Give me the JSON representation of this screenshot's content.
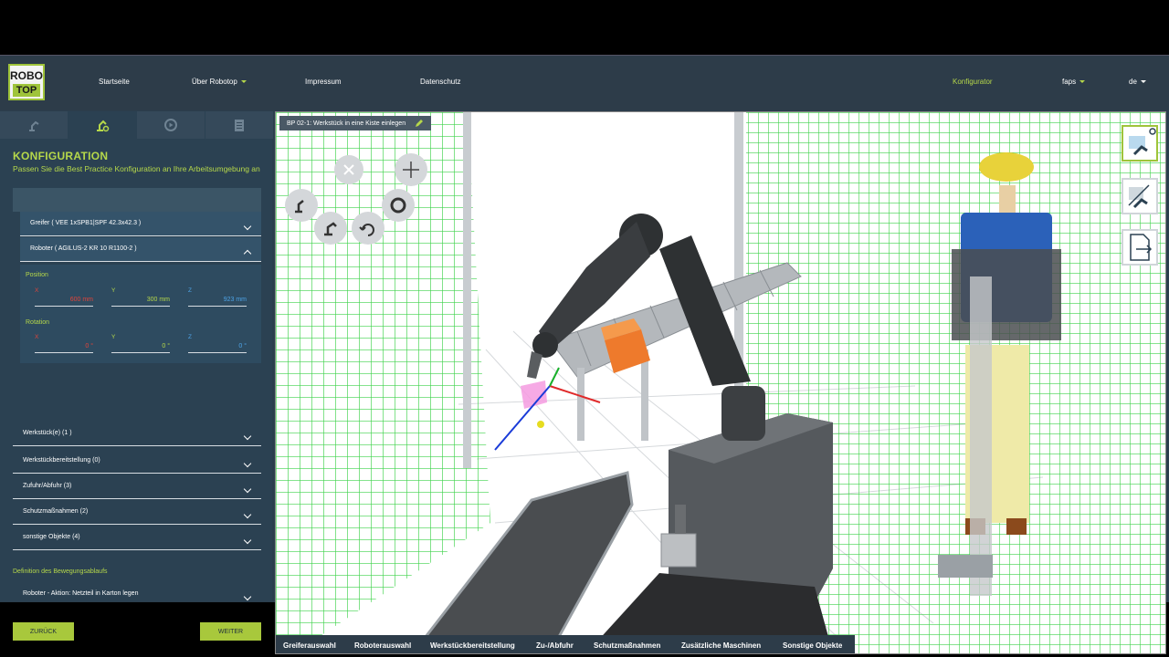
{
  "logo": {
    "line1": "ROBO",
    "line2": "TOP"
  },
  "nav": {
    "home": "Startseite",
    "about": "Über Robotop",
    "impressum": "Impressum",
    "privacy": "Datenschutz",
    "configurator": "Konfigurator",
    "user": "faps",
    "lang": "de"
  },
  "sidebar": {
    "title": "KONFIGURATION",
    "subtitle": "Passen Sie die Best Practice Konfiguration an Ihre Arbeitsumgebung an",
    "sections": [
      {
        "label": "Greifer ( VEE 1xSPB1|SPF 42.3x42.3 )"
      },
      {
        "label": "Roboter ( AGILUS-2 KR 10 R1100-2 )"
      },
      {
        "label": "Werkstück(e) (1 )"
      },
      {
        "label": "Werkstückbereitstellung (0)"
      },
      {
        "label": "Zufuhr/Abfuhr (3)"
      },
      {
        "label": "Schutzmaßnahmen (2)"
      },
      {
        "label": "sonstige Objekte (4)"
      }
    ],
    "position": {
      "label": "Position",
      "x_label": "X",
      "x_value": "600",
      "x_unit": "mm",
      "y_label": "Y",
      "y_value": "300",
      "y_unit": "mm",
      "z_label": "Z",
      "z_value": "923",
      "z_unit": "mm"
    },
    "rotation": {
      "label": "Rotation",
      "x_label": "X",
      "x_value": "0",
      "x_unit": "°",
      "y_label": "Y",
      "y_value": "0",
      "y_unit": "°",
      "z_label": "Z",
      "z_value": "0",
      "z_unit": "°"
    },
    "motion_heading": "Definition des Bewegungsablaufs",
    "motion_item": "Roboter - Aktion: Netzteil in Karton legen",
    "back_button": "ZURÜCK",
    "next_button": "WEITER"
  },
  "viewport": {
    "title": "BP 02-1: Werkstück in eine Kiste einlegen"
  },
  "bottombar": {
    "items": [
      "Greiferauswahl",
      "Roboterauswahl",
      "Werkstückbereitstellung",
      "Zu-/Abfuhr",
      "Schutzmaßnahmen",
      "Zusätzliche Maschinen",
      "Sonstige Objekte"
    ]
  },
  "colors": {
    "accent": "#b6d84a",
    "sidebar": "#2b4152",
    "topbar": "#2d3c49",
    "fence": "#3ed24a"
  }
}
